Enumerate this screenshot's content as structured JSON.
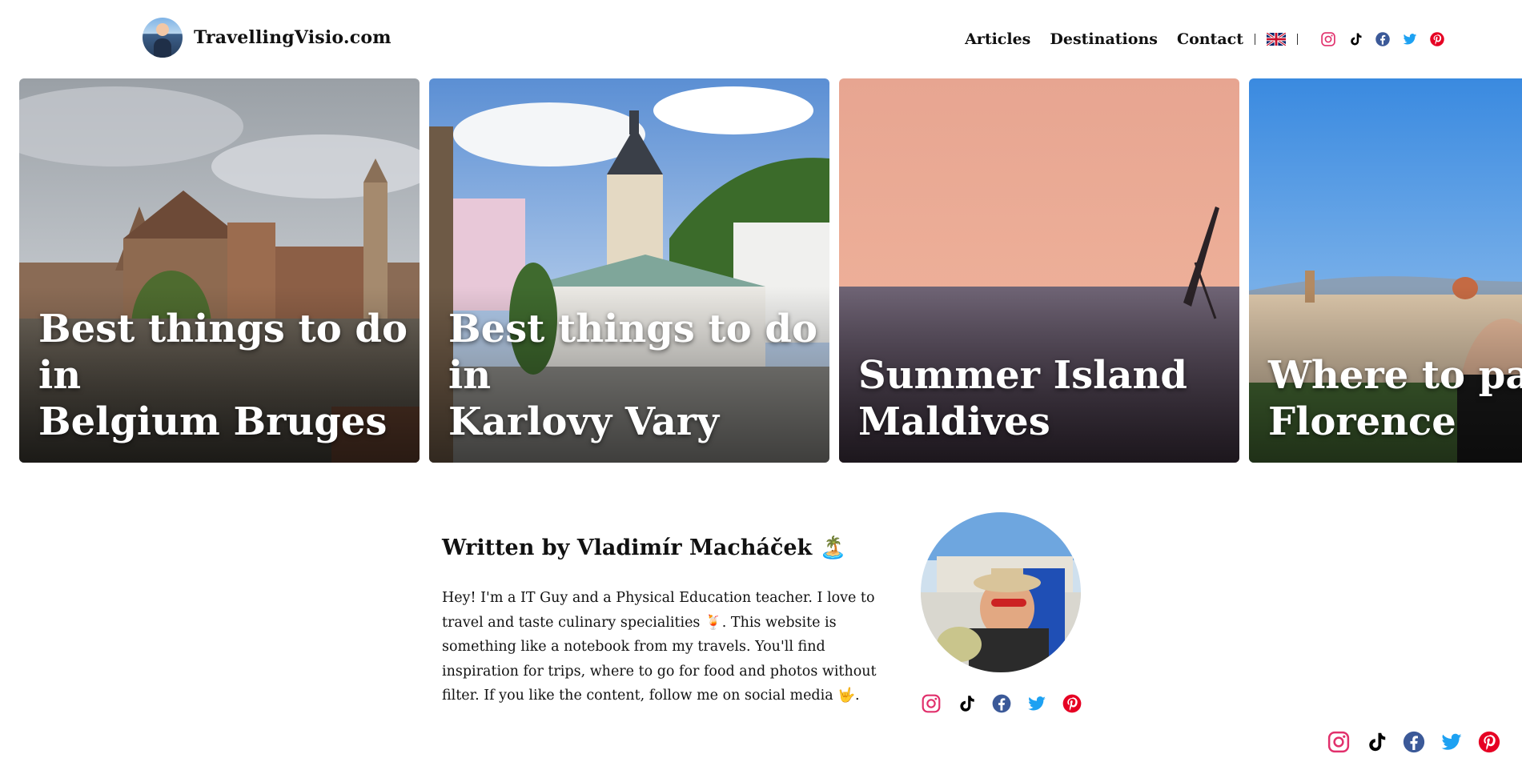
{
  "header": {
    "site_name": "TravellingVisio.com",
    "nav": [
      "Articles",
      "Destinations",
      "Contact"
    ],
    "language_flag": "uk-flag",
    "social_icons": [
      "instagram-icon",
      "tiktok-icon",
      "facebook-icon",
      "twitter-icon",
      "pinterest-icon"
    ]
  },
  "cards": [
    {
      "title": "Best things to do in\nBelgium Bruges"
    },
    {
      "title": "Best things to do in\nKarlovy Vary"
    },
    {
      "title": "Summer Island\nMaldives"
    },
    {
      "title": "Where to park\nFlorence"
    }
  ],
  "author": {
    "heading": "Written by Vladimír Macháček 🏝️",
    "bio": "Hey! I'm a IT Guy and a Physical Education teacher. I love to travel and taste culinary specialities 🍹. This website is something like a notebook from my travels. You'll find inspiration for trips, where to go for food and photos without filter. If you like the content, follow me on social media 🤟.",
    "social_icons": [
      "instagram-icon",
      "tiktok-icon",
      "facebook-icon",
      "twitter-icon",
      "pinterest-icon"
    ]
  },
  "colors": {
    "instagram": "#e1306c",
    "facebook": "#3b5998",
    "twitter": "#1da1f2",
    "pinterest": "#e60023",
    "tiktok": "#000000"
  }
}
